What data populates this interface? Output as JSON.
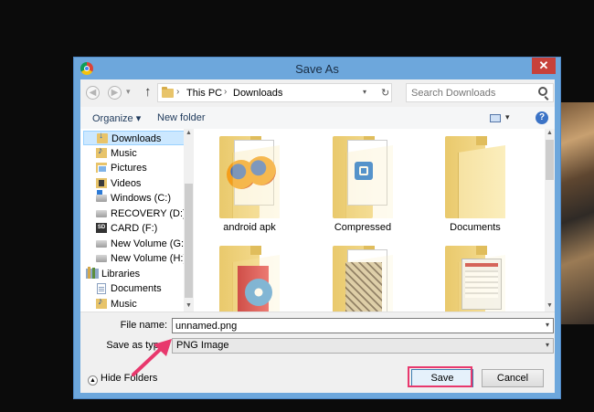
{
  "dialog": {
    "title": "Save As",
    "close_icon_glyph": "✕"
  },
  "address": {
    "back_icon": "back-arrow-icon",
    "forward_icon": "forward-arrow-icon",
    "up_icon": "up-arrow-icon",
    "crumbs": [
      "This PC",
      "Downloads"
    ],
    "search_placeholder": "Search Downloads"
  },
  "toolbar": {
    "organize_label": "Organize ▾",
    "new_folder_label": "New folder",
    "help_glyph": "?"
  },
  "sidebar": {
    "items": [
      {
        "label": "Downloads",
        "icon": "downloads-folder-icon",
        "selected": true
      },
      {
        "label": "Music",
        "icon": "music-folder-icon"
      },
      {
        "label": "Pictures",
        "icon": "pictures-folder-icon"
      },
      {
        "label": "Videos",
        "icon": "videos-folder-icon"
      },
      {
        "label": "Windows (C:)",
        "icon": "windows-drive-icon"
      },
      {
        "label": "RECOVERY (D:)",
        "icon": "drive-icon"
      },
      {
        "label": "CARD (F:)",
        "icon": "sd-card-icon"
      },
      {
        "label": "New Volume (G:)",
        "icon": "drive-icon"
      },
      {
        "label": "New Volume (H:)",
        "icon": "drive-icon"
      },
      {
        "label": "Libraries",
        "icon": "libraries-icon"
      },
      {
        "label": "Documents",
        "icon": "documents-icon"
      },
      {
        "label": "Music",
        "icon": "music-folder-icon"
      }
    ],
    "sd_text": "SD"
  },
  "files": {
    "items": [
      {
        "label": "android apk",
        "icon": "firefox-folder-icon"
      },
      {
        "label": "Compressed",
        "icon": "app-folder-icon"
      },
      {
        "label": "Documents",
        "icon": "folder-icon"
      },
      {
        "label": "",
        "icon": "red-book-folder-icon"
      },
      {
        "label": "",
        "icon": "comic-folder-icon"
      },
      {
        "label": "",
        "icon": "screenshot-folder-icon"
      }
    ]
  },
  "form": {
    "file_name_label": "File name:",
    "file_name_value": "unnamed.png",
    "save_type_label": "Save as type:",
    "save_type_value": "PNG Image"
  },
  "footer": {
    "hide_folders_label": "Hide Folders",
    "save_label": "Save",
    "cancel_label": "Cancel"
  },
  "colors": {
    "annotation_pink": "#e8386d",
    "title_bar_blue": "#6da7dc",
    "close_red": "#c7413a"
  }
}
